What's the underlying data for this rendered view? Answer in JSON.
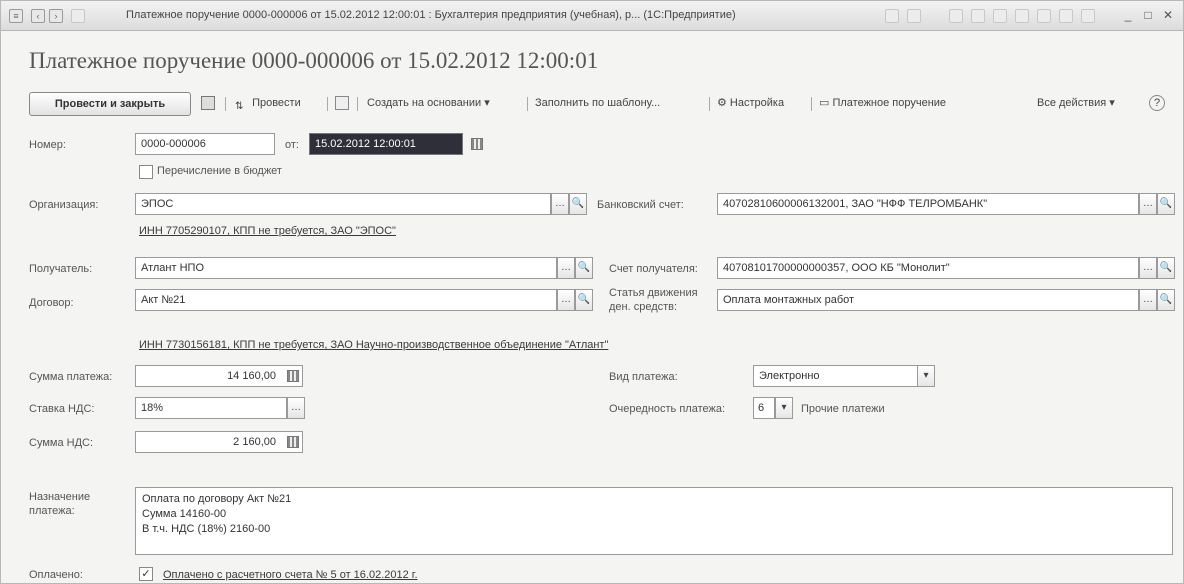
{
  "window": {
    "title": "Платежное поручение 0000-000006 от 15.02.2012 12:00:01 : Бухгалтерия предприятия (учебная), р... (1С:Предприятие)"
  },
  "page_title": "Платежное поручение 0000-000006 от 15.02.2012 12:00:01",
  "toolbar": {
    "post_and_close": "Провести и закрыть",
    "post": "Провести",
    "create_based_on": "Создать на основании",
    "fill_from_template": "Заполнить по шаблону...",
    "settings": "Настройка",
    "payment_order": "Платежное поручение",
    "all_actions": "Все действия"
  },
  "form": {
    "number_label": "Номер:",
    "number_value": "0000-000006",
    "date_label": "от:",
    "date_value": "15.02.2012 12:00:01",
    "budget_checkbox_label": "Перечисление в бюджет",
    "budget_checked": false,
    "organization_label": "Организация:",
    "organization_value": "ЭПОС",
    "bank_account_label": "Банковский счет:",
    "bank_account_value": "40702810600006132001, ЗАО \"НФФ ТЕЛРОМБАНК\"",
    "org_inn_link": "ИНН 7705290107, КПП не требуется, ЗАО \"ЭПОС\"",
    "recipient_label": "Получатель:",
    "recipient_value": "Атлант НПО",
    "recipient_account_label": "Счет получателя:",
    "recipient_account_value": "40708101700000000357, ООО КБ \"Монолит\"",
    "contract_label": "Договор:",
    "contract_value": "Акт №21",
    "cash_flow_label_1": "Статья движения",
    "cash_flow_label_2": "ден. средств:",
    "cash_flow_value": "Оплата монтажных работ",
    "recipient_inn_link": "ИНН 7730156181, КПП не требуется, ЗАО Научно-производственное объединение \"Атлант\"",
    "amount_label": "Сумма платежа:",
    "amount_value": "14 160,00",
    "payment_type_label": "Вид платежа:",
    "payment_type_value": "Электронно",
    "vat_rate_label": "Ставка НДС:",
    "vat_rate_value": "18%",
    "priority_label": "Очередность платежа:",
    "priority_value": "6",
    "priority_desc": "Прочие платежи",
    "vat_amount_label": "Сумма НДС:",
    "vat_amount_value": "2 160,00",
    "purpose_label_1": "Назначение",
    "purpose_label_2": "платежа:",
    "purpose_lines": [
      "Оплата по договору Акт №21",
      "Сумма 14160-00",
      "В т.ч. НДС  (18%) 2160-00"
    ],
    "paid_label": "Оплачено:",
    "paid_checked": true,
    "paid_text": "Оплачено с расчетного счета № 5 от 16.02.2012 г."
  },
  "colors": {
    "window_bg": "#f4f4f2",
    "date_selection": "#2f2f3a"
  }
}
